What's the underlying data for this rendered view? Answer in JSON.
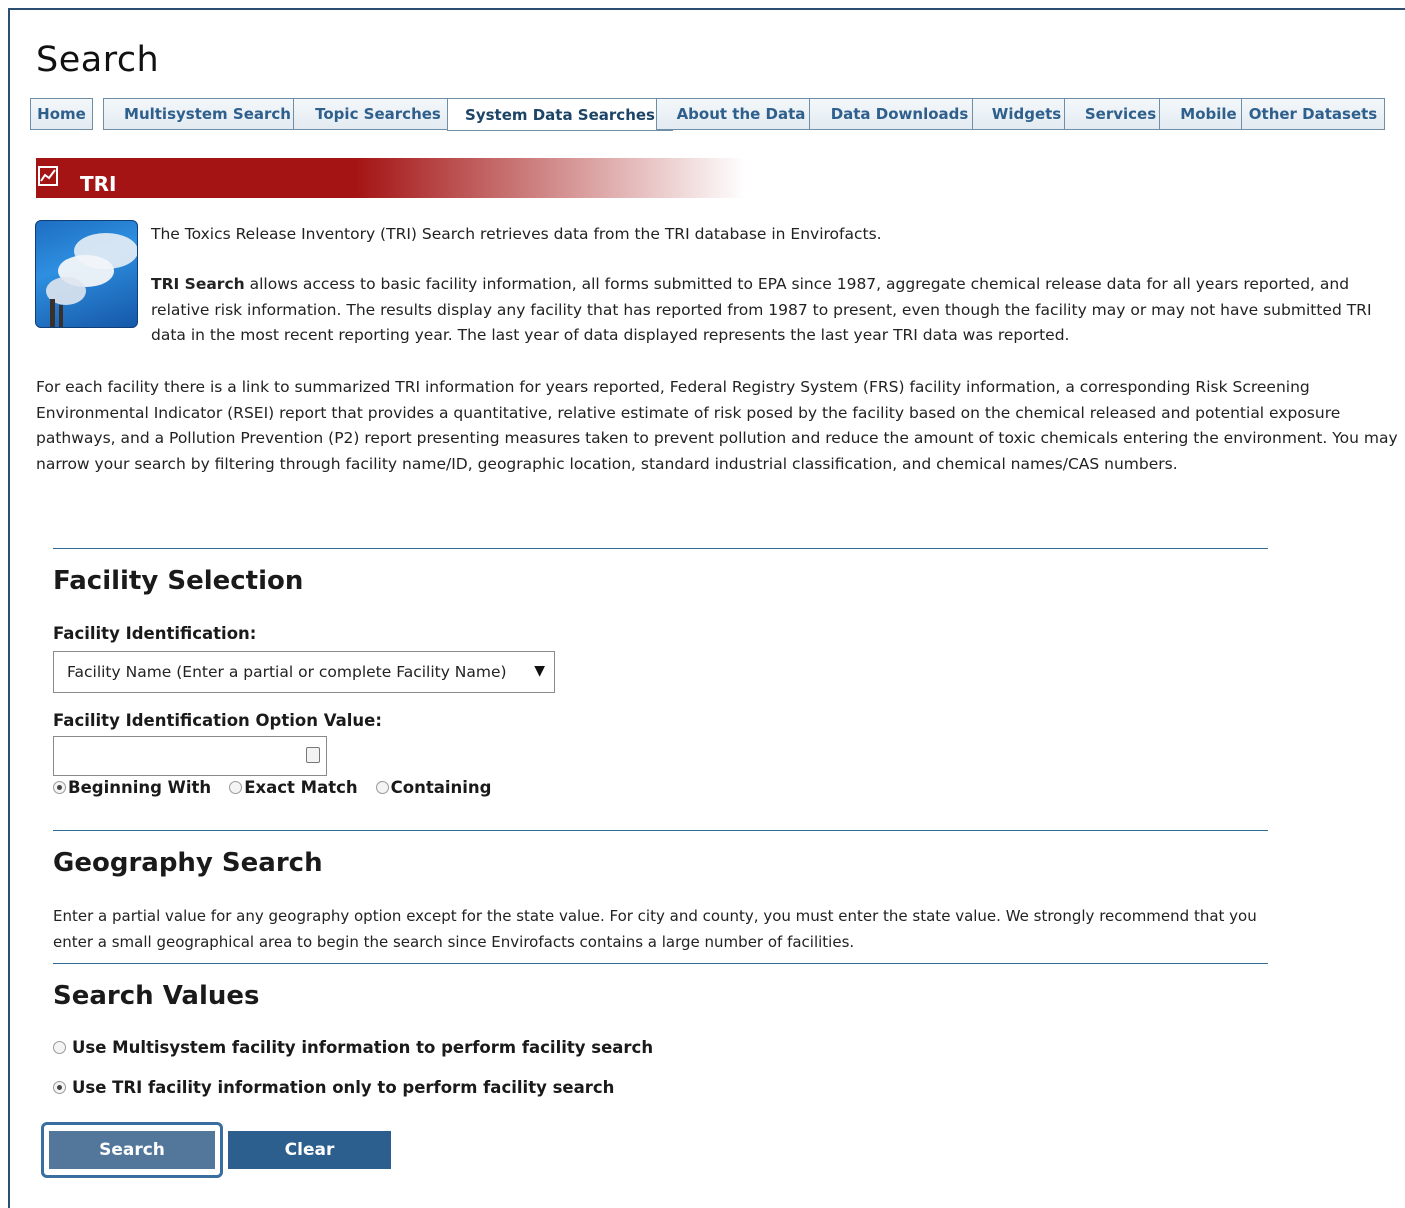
{
  "page_title": "Search",
  "tabs": [
    {
      "label": "Home",
      "active": false
    },
    {
      "label": "Multisystem Search",
      "active": false
    },
    {
      "label": "Topic Searches",
      "active": false
    },
    {
      "label": "System Data Searches",
      "active": true
    },
    {
      "label": "About the Data",
      "active": false
    },
    {
      "label": "Data Downloads",
      "active": false
    },
    {
      "label": "Widgets",
      "active": false
    },
    {
      "label": "Services",
      "active": false
    },
    {
      "label": "Mobile",
      "active": false
    },
    {
      "label": "Other Datasets",
      "active": false
    }
  ],
  "banner": {
    "title": "TRI",
    "icon": "chart-icon",
    "color": "#a41414"
  },
  "intro": {
    "p1": "The Toxics Release Inventory (TRI) Search retrieves data from the TRI database in Envirofacts.",
    "p2_bold": "TRI Search",
    "p2_rest": " allows access to basic facility information, all forms submitted to EPA since 1987, aggregate chemical release data for all years reported, and relative risk information. The results display any facility that has reported from 1987 to present, even though the facility may or may not have submitted TRI data in the most recent reporting year. The last year of data displayed represents the last year TRI data was reported.",
    "p3": "For each facility there is a link to summarized TRI information for years reported, Federal Registry System (FRS) facility information, a corresponding Risk Screening Environmental Indicator (RSEI) report that provides a quantitative, relative estimate of risk posed by the facility based on the chemical released and potential exposure pathways, and a Pollution Prevention (P2) report presenting measures taken to prevent pollution and reduce the amount of toxic chemicals entering the environment. You may narrow your search by filtering through facility name/ID, geographic location, standard industrial classification, and chemical names/CAS numbers."
  },
  "facility_selection": {
    "heading": "Facility Selection",
    "id_label": "Facility Identification:",
    "id_select_value": "Facility Name (Enter a partial or complete Facility Name)",
    "option_value_label": "Facility Identification Option Value:",
    "option_value": "",
    "match_options": [
      {
        "label": "Beginning With",
        "selected": true
      },
      {
        "label": "Exact Match",
        "selected": false
      },
      {
        "label": "Containing",
        "selected": false
      }
    ]
  },
  "geography": {
    "heading": "Geography Search",
    "text": "Enter a partial value for any geography option except for the state value. For city and county, you must enter the state value. We strongly recommend that you enter a small geographical area to begin the search since Envirofacts contains a large number of facilities."
  },
  "search_values": {
    "heading": "Search Values",
    "options": [
      {
        "label": "Use Multisystem facility information to perform facility search",
        "selected": false
      },
      {
        "label": "Use TRI facility information only to perform facility search",
        "selected": true
      }
    ]
  },
  "buttons": {
    "search": "Search",
    "clear": "Clear"
  }
}
